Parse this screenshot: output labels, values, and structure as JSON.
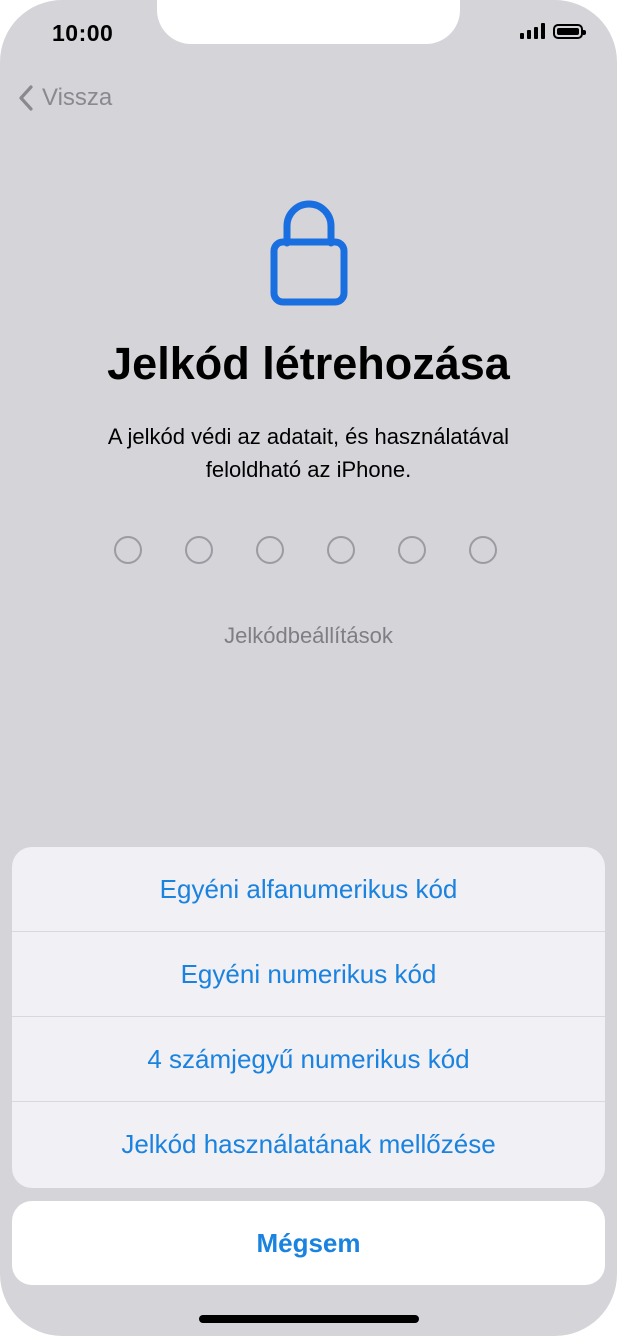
{
  "status_bar": {
    "time": "10:00",
    "signal_icon": "cellular-signal-icon",
    "battery_icon": "battery-icon"
  },
  "nav": {
    "back_label": "Vissza",
    "back_icon": "chevron-left-icon"
  },
  "header": {
    "icon": "lock-icon",
    "title": "Jelkód létrehozása",
    "subtitle_line1": "A jelkód védi az adatait, és használatával",
    "subtitle_line2": "feloldható az iPhone."
  },
  "passcode": {
    "digit_count": 6,
    "options_label": "Jelkódbeállítások"
  },
  "action_sheet": {
    "items": [
      {
        "label": "Egyéni alfanumerikus kód"
      },
      {
        "label": "Egyéni numerikus kód"
      },
      {
        "label": "4 számjegyű numerikus kód"
      },
      {
        "label": "Jelkód használatának mellőzése"
      }
    ],
    "cancel_label": "Mégsem"
  },
  "colors": {
    "accent": "#1a82df",
    "lock_icon": "#1a6fe0",
    "background": "#d5d4d9",
    "sheet": "#f1f0f4"
  }
}
